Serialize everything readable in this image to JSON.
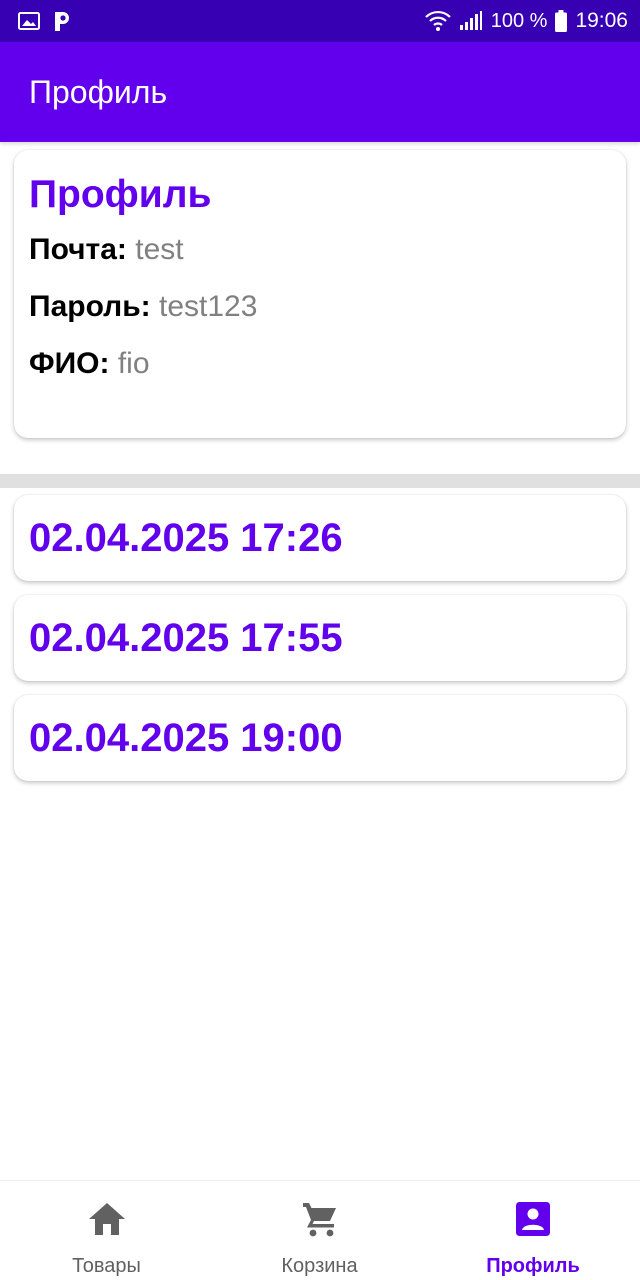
{
  "status_bar": {
    "battery": "100 %",
    "time": "19:06",
    "icons": [
      "image-icon",
      "p-app-icon",
      "wifi-icon",
      "signal-icon",
      "battery-icon"
    ]
  },
  "app_bar": {
    "title": "Профиль"
  },
  "profile": {
    "title": "Профиль",
    "fields": [
      {
        "label": "Почта:",
        "value": "test"
      },
      {
        "label": "Пароль:",
        "value": "test123"
      },
      {
        "label": "ФИО:",
        "value": "fio"
      }
    ]
  },
  "orders": [
    {
      "datetime": "02.04.2025 17:26"
    },
    {
      "datetime": "02.04.2025 17:55"
    },
    {
      "datetime": "02.04.2025 19:00"
    }
  ],
  "bottom_nav": {
    "items": [
      {
        "label": "Товары",
        "icon": "home-icon",
        "active": false
      },
      {
        "label": "Корзина",
        "icon": "cart-icon",
        "active": false
      },
      {
        "label": "Профиль",
        "icon": "account-box-icon",
        "active": true
      }
    ]
  },
  "colors": {
    "primary": "#6200ee",
    "primary_dark": "#3700b3",
    "inactive": "#616161",
    "value_gray": "#808080"
  }
}
